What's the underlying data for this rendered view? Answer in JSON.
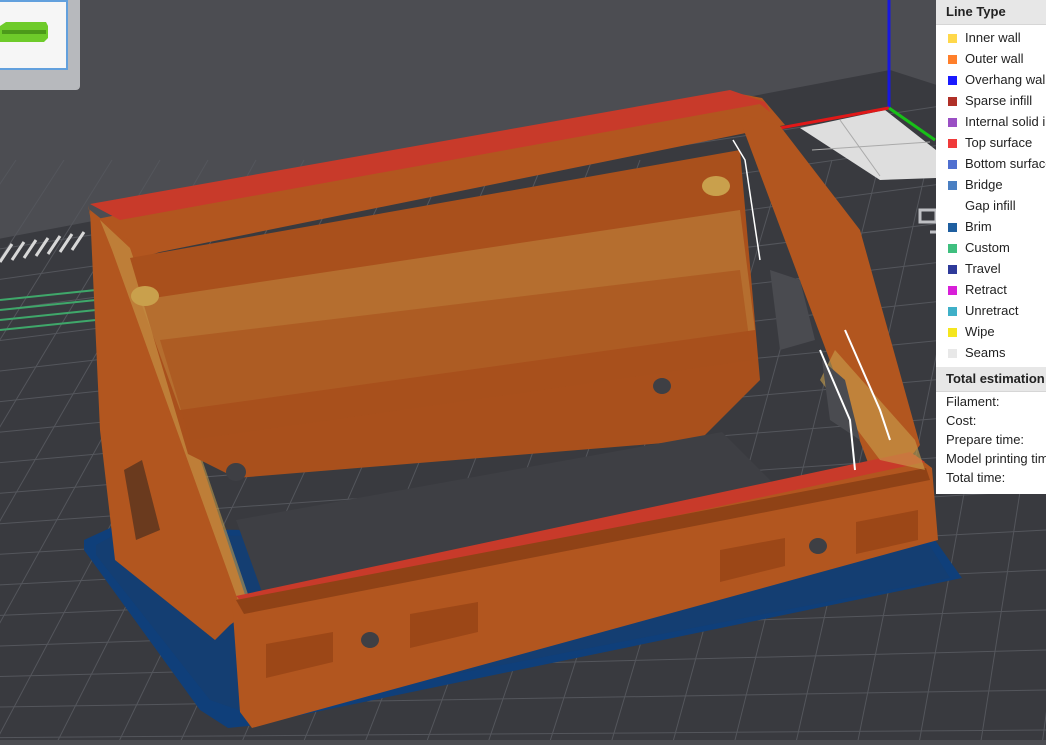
{
  "legend": {
    "line_type_title": "Line Type",
    "line_types": [
      {
        "label": "Inner wall",
        "color": "#ffd84a"
      },
      {
        "label": "Outer wall",
        "color": "#ff7f2a"
      },
      {
        "label": "Overhang wall",
        "color": "#1a1aff"
      },
      {
        "label": "Sparse infill",
        "color": "#b03028"
      },
      {
        "label": "Internal solid infill",
        "color": "#9a4fc4"
      },
      {
        "label": "Top surface",
        "color": "#f03a3a"
      },
      {
        "label": "Bottom surface",
        "color": "#4f6fd0"
      },
      {
        "label": "Bridge",
        "color": "#4a7fc2"
      },
      {
        "label": "Gap infill",
        "color": "#ffffff"
      },
      {
        "label": "Brim",
        "color": "#1f5fa0"
      },
      {
        "label": "Custom",
        "color": "#3fbf7f"
      },
      {
        "label": "Travel",
        "color": "#2e3a9a"
      },
      {
        "label": "Retract",
        "color": "#d81fd8"
      },
      {
        "label": "Unretract",
        "color": "#3fb0c8"
      },
      {
        "label": "Wipe",
        "color": "#f5e61e"
      },
      {
        "label": "Seams",
        "color": "#e8e8e8"
      }
    ],
    "estimation_title": "Total estimation",
    "estimation_rows": [
      {
        "label": "Filament:"
      },
      {
        "label": "Cost:"
      },
      {
        "label": "Prepare time:"
      },
      {
        "label": "Model printing time:"
      },
      {
        "label": "Total time:"
      }
    ]
  },
  "colors": {
    "model": "#b2561f",
    "model_dark": "#8f4216",
    "rim": "#c83a2a",
    "infill": "#c9a04c",
    "brim": "#0f3f7a",
    "bed": "#37383d",
    "background": "#4c4d52"
  }
}
